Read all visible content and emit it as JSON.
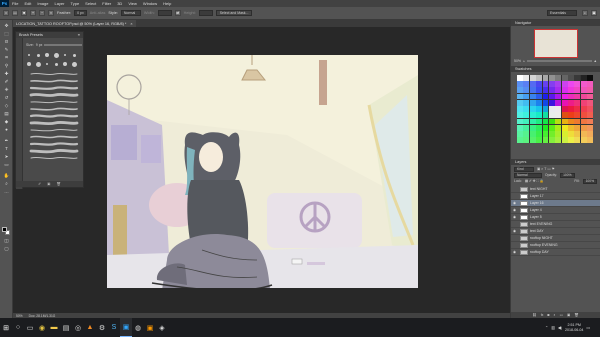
{
  "menubar": {
    "app_logo": "Ps",
    "items": [
      "File",
      "Edit",
      "Image",
      "Layer",
      "Type",
      "Select",
      "Filter",
      "3D",
      "View",
      "Window",
      "Help"
    ]
  },
  "options_bar": {
    "feather_label": "Feather:",
    "feather_value": "0 px",
    "antialias_label": "Anti-alias",
    "style_label": "Style:",
    "style_value": "Normal",
    "width_label": "Width:",
    "height_label": "Height:",
    "select_mask_button": "Select and Mask...",
    "workspace_value": "Essentials"
  },
  "document_tab": {
    "title": "LOCATION_TATTOO ROOFTOP.psd @ 50% (Layer 16, RGB/8) *",
    "close": "×"
  },
  "brush_panel": {
    "title": "Brush Presets",
    "size_label": "Size:",
    "size_value": "9 px",
    "preset_count": 13
  },
  "navigator": {
    "title": "Navigator",
    "zoom": "50%"
  },
  "swatches": {
    "title": "Swatches"
  },
  "layers": {
    "title": "Layers",
    "kind_label": "Kind",
    "blend_mode": "Normal",
    "opacity_label": "Opacity:",
    "opacity_value": "100%",
    "lock_label": "Lock:",
    "fill_label": "Fill:",
    "fill_value": "100%",
    "items": [
      {
        "name": "text NIGHT",
        "visible": false,
        "active": false
      },
      {
        "name": "Layer 17",
        "visible": false,
        "active": false
      },
      {
        "name": "Layer 16",
        "visible": true,
        "active": true
      },
      {
        "name": "Layer 4",
        "visible": true,
        "active": false
      },
      {
        "name": "Layer 5",
        "visible": true,
        "active": false
      },
      {
        "name": "text EVENING",
        "visible": false,
        "active": false
      },
      {
        "name": "text DAY",
        "visible": true,
        "active": false
      },
      {
        "name": "rooftop NIGHT",
        "visible": false,
        "active": false
      },
      {
        "name": "rooftop EVENING",
        "visible": false,
        "active": false
      },
      {
        "name": "rooftop DAY",
        "visible": true,
        "active": false
      }
    ]
  },
  "status_bar": {
    "zoom": "50%",
    "doc_info": "Doc: 28.1M/1.31G"
  },
  "taskbar": {
    "time": "2:51 PM",
    "date": "2018-06-04"
  },
  "colors": {
    "panel": "#535353",
    "panel_dark": "#424242",
    "canvas_bg": "#282828",
    "highlight": "#6d7a8c",
    "foreground": "#000000",
    "background": "#ffffff"
  }
}
